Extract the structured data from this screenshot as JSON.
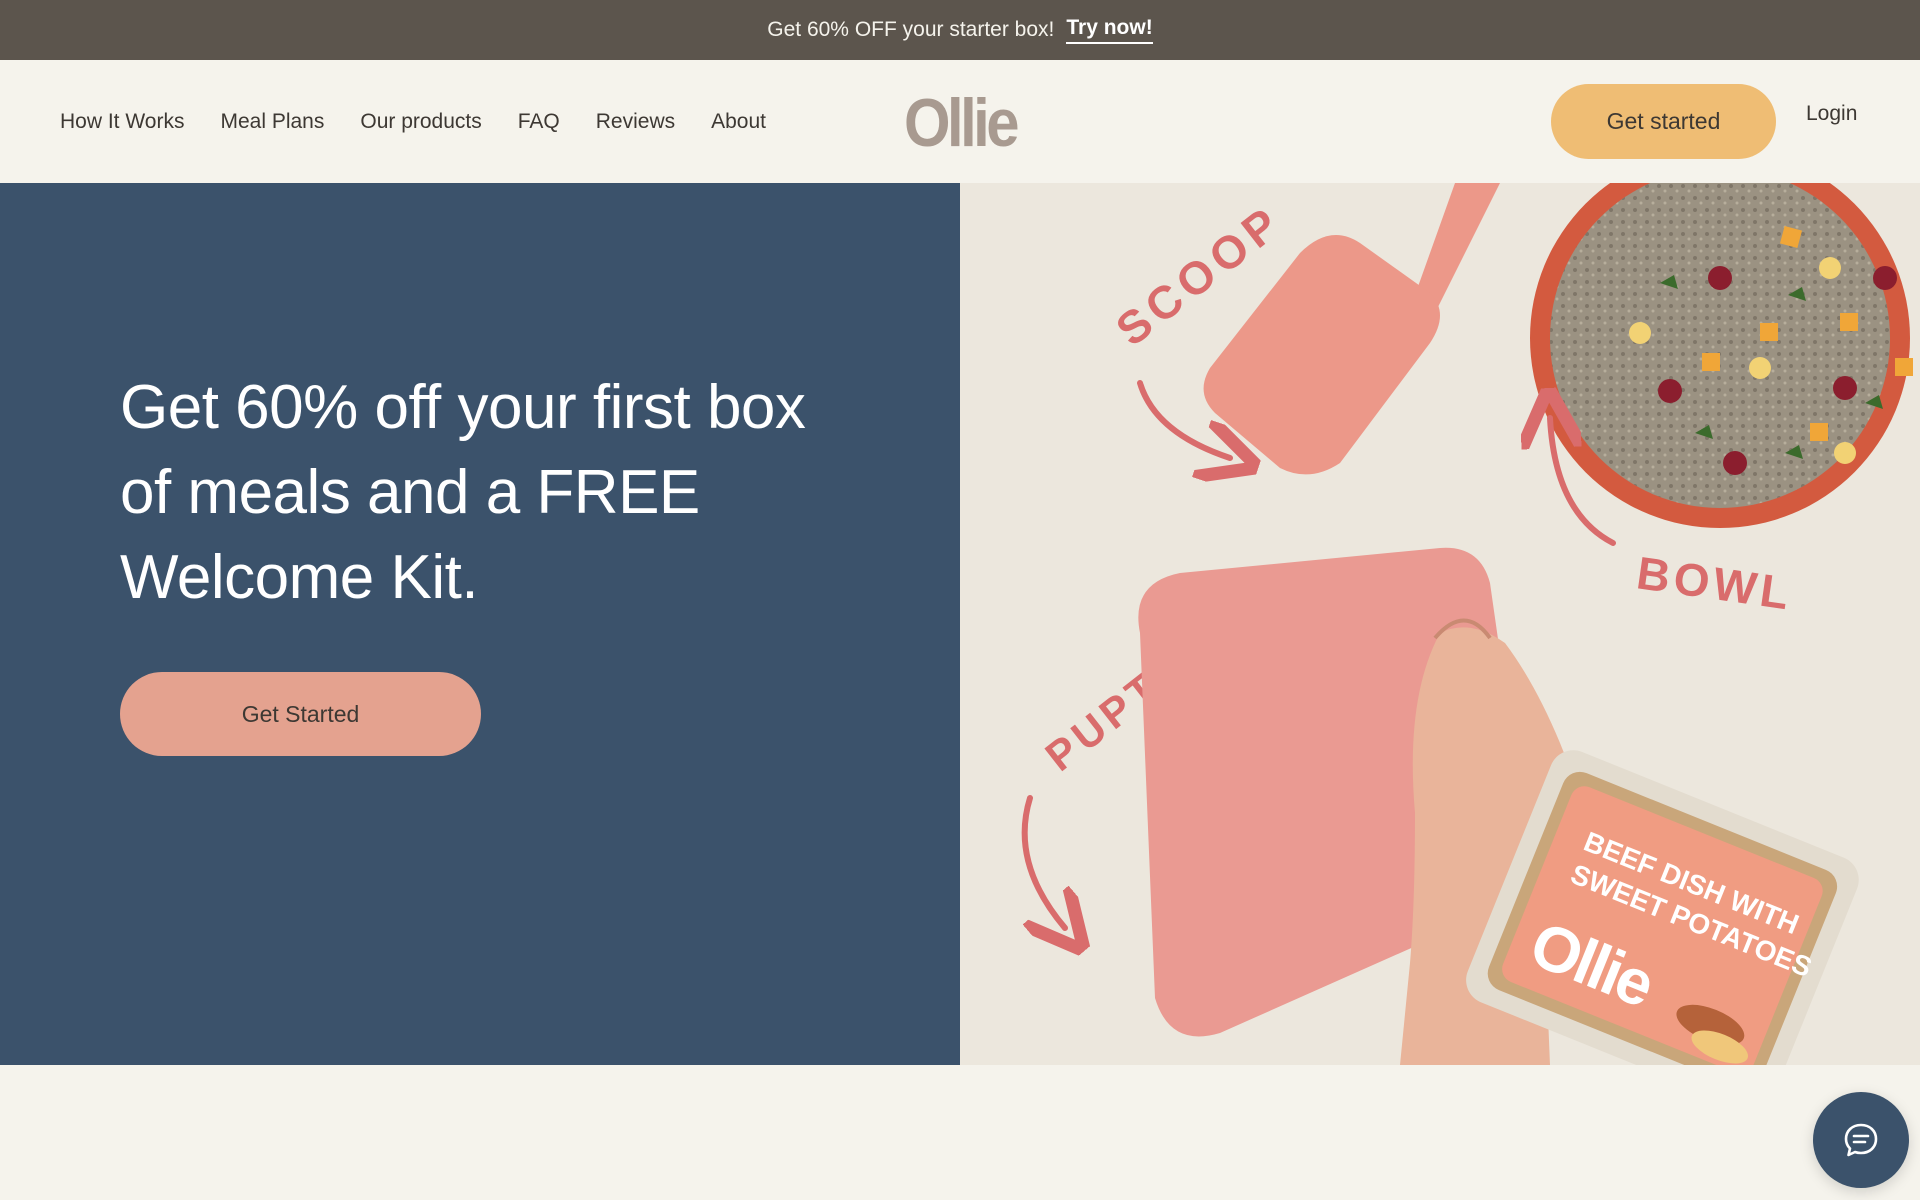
{
  "promo": {
    "text": "Get 60% OFF your starter box!",
    "link_label": "Try now!"
  },
  "header": {
    "nav": [
      {
        "label": "How It Works"
      },
      {
        "label": "Meal Plans"
      },
      {
        "label": "Our products"
      },
      {
        "label": "FAQ"
      },
      {
        "label": "Reviews"
      },
      {
        "label": "About"
      }
    ],
    "logo": "Ollie",
    "cta_label": "Get started",
    "login_label": "Login"
  },
  "hero": {
    "heading": "Get 60% off your first box of meals and a FREE Welcome Kit.",
    "cta_label": "Get Started",
    "image": {
      "labels": {
        "scoop": "SCOOP",
        "bowl": "BOWL",
        "puptainer": "PUPTAINER",
        "package_line1": "BEEF DISH WITH",
        "package_line2": "SWEET POTATOES",
        "package_brand": "Ollie"
      }
    }
  },
  "colors": {
    "promo_bg": "#5c554d",
    "header_bg": "#f5f3ec",
    "hero_left_bg": "#3b526b",
    "accent_yellow": "#efbd74",
    "accent_salmon": "#e4a28f",
    "illustration_pink": "#d96c6c"
  },
  "icons": {
    "chat": "chat-bubble-icon"
  }
}
